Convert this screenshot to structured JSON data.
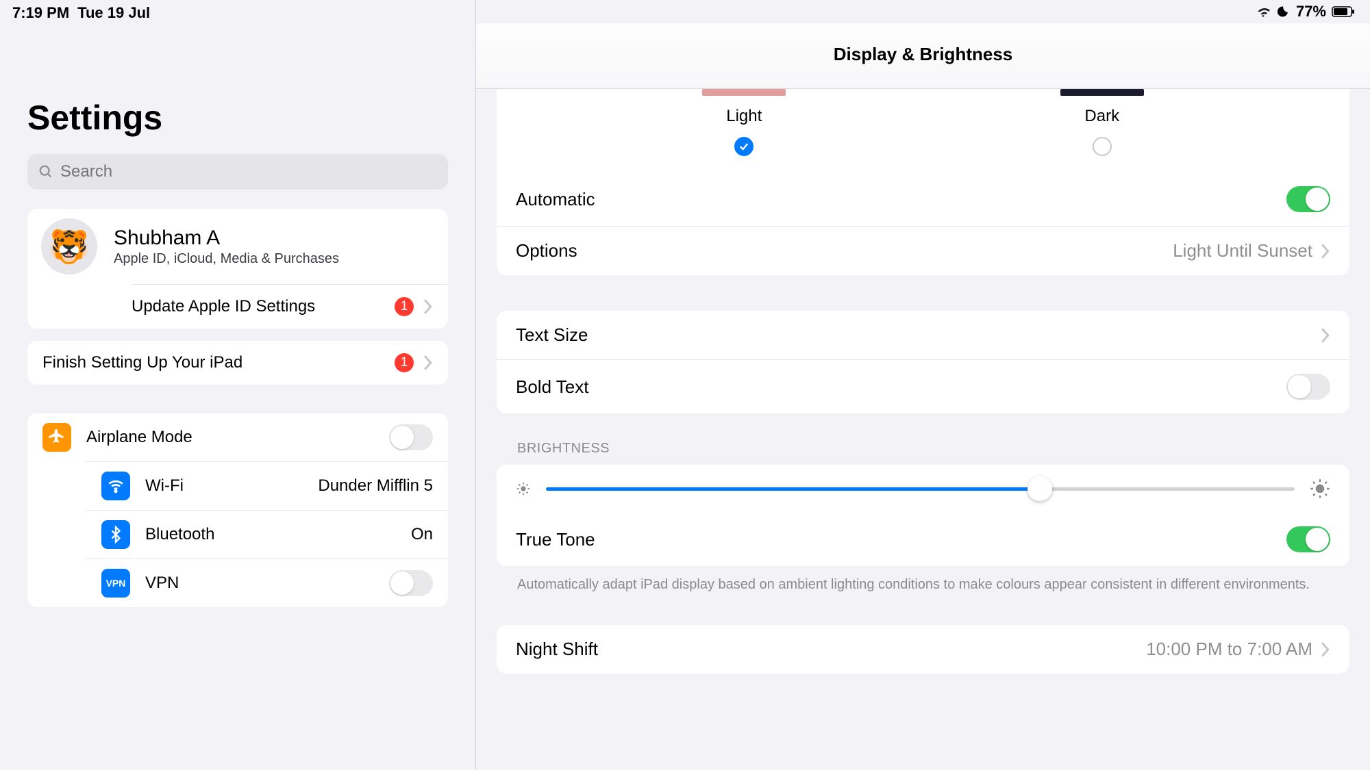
{
  "status": {
    "time": "7:19 PM",
    "date": "Tue 19 Jul",
    "battery": "77%"
  },
  "sidebar": {
    "title": "Settings",
    "search_placeholder": "Search",
    "profile": {
      "name": "Shubham A",
      "subtitle": "Apple ID, iCloud, Media & Purchases",
      "avatar_emoji": "🐯"
    },
    "update_apple_id": {
      "label": "Update Apple ID Settings",
      "badge": "1"
    },
    "finish_setup": {
      "label": "Finish Setting Up Your iPad",
      "badge": "1"
    },
    "items": [
      {
        "label": "Airplane Mode",
        "value": "",
        "toggle": false
      },
      {
        "label": "Wi-Fi",
        "value": "Dunder Mifflin 5"
      },
      {
        "label": "Bluetooth",
        "value": "On"
      },
      {
        "label": "VPN",
        "value": "",
        "toggle": false
      }
    ],
    "vpn_text": "VPN"
  },
  "main": {
    "title": "Display & Brightness",
    "appearance": {
      "light": "Light",
      "dark": "Dark",
      "selected": "light"
    },
    "automatic": {
      "label": "Automatic",
      "on": true
    },
    "options": {
      "label": "Options",
      "value": "Light Until Sunset"
    },
    "text_size": {
      "label": "Text Size"
    },
    "bold_text": {
      "label": "Bold Text",
      "on": false
    },
    "brightness_header": "BRIGHTNESS",
    "true_tone": {
      "label": "True Tone",
      "on": true
    },
    "true_tone_footnote": "Automatically adapt iPad display based on ambient lighting conditions to make colours appear consistent in different environments.",
    "night_shift": {
      "label": "Night Shift",
      "value": "10:00 PM to 7:00 AM"
    }
  }
}
